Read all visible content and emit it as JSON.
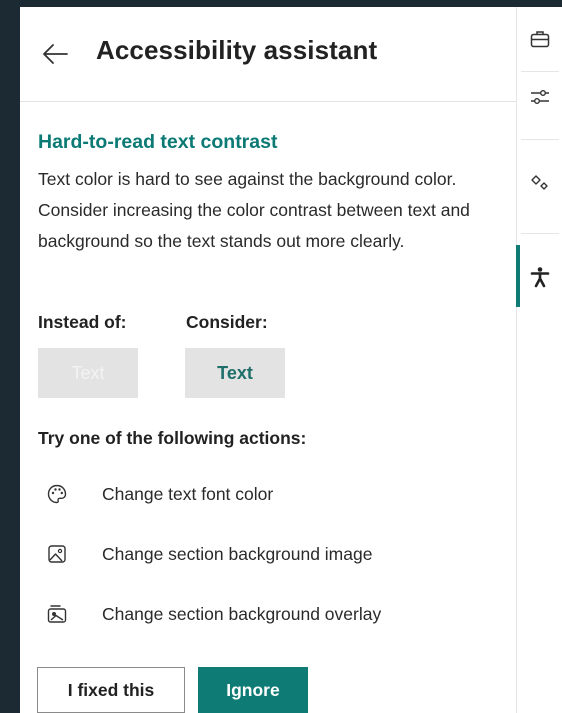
{
  "header": {
    "title": "Accessibility assistant",
    "back_icon": "arrow-left-icon"
  },
  "issue": {
    "title": "Hard-to-read text contrast",
    "description": "Text color is hard to see against the background color. Consider increasing the color contrast between text and background so the text stands out more clearly."
  },
  "comparison": {
    "instead_label": "Instead of:",
    "consider_label": "Consider:",
    "bad_sample": "Text",
    "good_sample": "Text",
    "bad_text_color": "#f3f3f3",
    "good_text_color": "#1e6f6a",
    "swatch_background": "#e3e3e3"
  },
  "actions": {
    "heading": "Try one of the following actions:",
    "items": [
      {
        "label": "Change text font color",
        "icon": "palette-icon"
      },
      {
        "label": "Change section background image",
        "icon": "image-icon"
      },
      {
        "label": "Change section background overlay",
        "icon": "overlay-icon"
      }
    ]
  },
  "buttons": {
    "fixed": "I fixed this",
    "ignore": "Ignore"
  },
  "rail": {
    "items": [
      {
        "icon": "briefcase-icon"
      },
      {
        "icon": "sliders-icon"
      },
      {
        "icon": "sparkle-design-icon"
      },
      {
        "icon": "accessibility-icon",
        "active": true
      }
    ]
  },
  "colors": {
    "accent": "#0e7c75",
    "issue_title": "#0b7a75",
    "frame": "#1b2a33"
  }
}
